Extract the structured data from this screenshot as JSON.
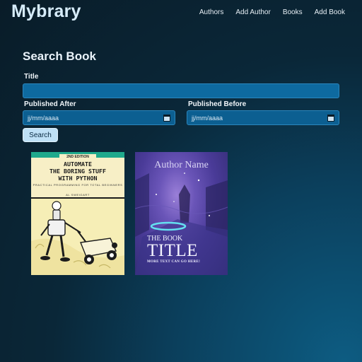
{
  "header": {
    "brand": "Mybrary",
    "nav": [
      "Authors",
      "Add Author",
      "Books",
      "Add Book"
    ]
  },
  "form": {
    "heading": "Search Book",
    "title_label": "Title",
    "title_value": "",
    "published_after_label": "Published After",
    "published_after_value": "jj/mm/aaaa",
    "published_before_label": "Published Before",
    "published_before_value": "jj/mm/aaaa",
    "search_button": "Search"
  },
  "books": [
    {
      "edition": "2ND EDITION",
      "title_lines": [
        "AUTOMATE",
        "THE BORING STUFF",
        "WITH PYTHON"
      ],
      "subtitle": "PRACTICAL PROGRAMMING FOR TOTAL BEGINNERS",
      "author": "AL SWEIGART"
    },
    {
      "author": "Author Name",
      "title_small": "THE BOOK",
      "title_big": "TITLE",
      "tagline": "MORE TEXT CAN GO HERE!"
    }
  ],
  "colors": {
    "background_dark": "#091c28",
    "background_accent": "#0d5c82",
    "input_fill": "#0e6aa0",
    "button_fill": "#bfe1f6"
  }
}
